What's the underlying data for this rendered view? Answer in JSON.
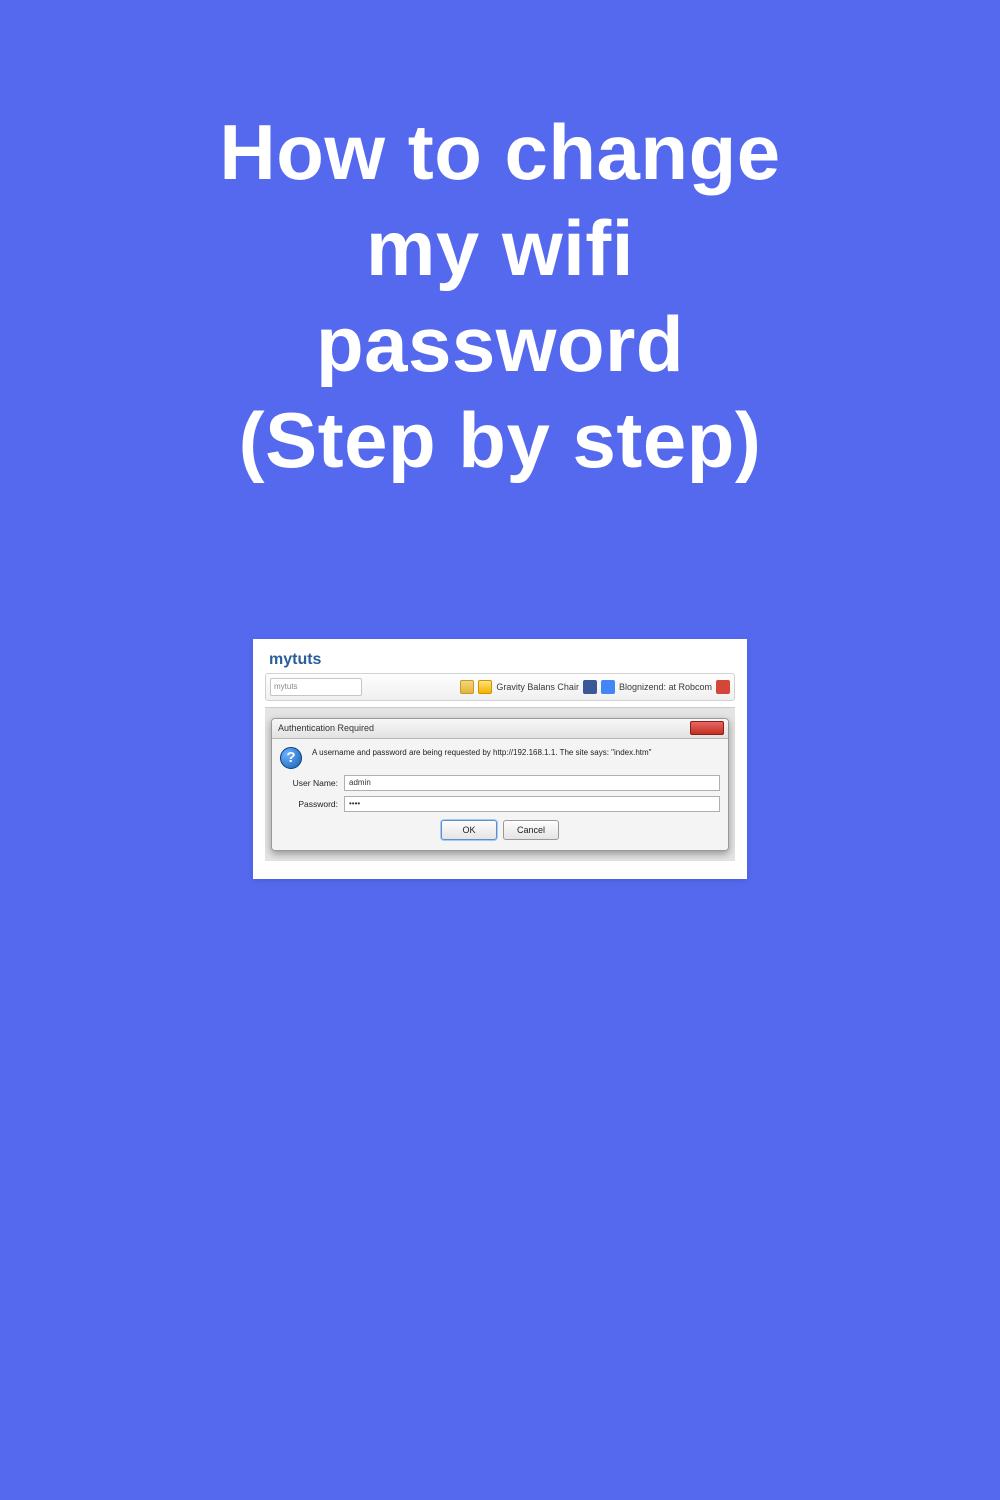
{
  "headline": "How to change\nmy wifi\npassword\n(Step by step)",
  "browser": {
    "brand": "mytuts",
    "url_text": "mytuts",
    "bookmark1": "Gravity Balans Chair",
    "bookmark2": "Blognizend: at Robcom"
  },
  "dialog": {
    "title": "Authentication Required",
    "message": "A username and password are being requested by http://192.168.1.1. The site says: \"index.htm\"",
    "username_label": "User Name:",
    "username_value": "admin",
    "password_label": "Password:",
    "password_value": "••••",
    "ok_label": "OK",
    "cancel_label": "Cancel"
  }
}
